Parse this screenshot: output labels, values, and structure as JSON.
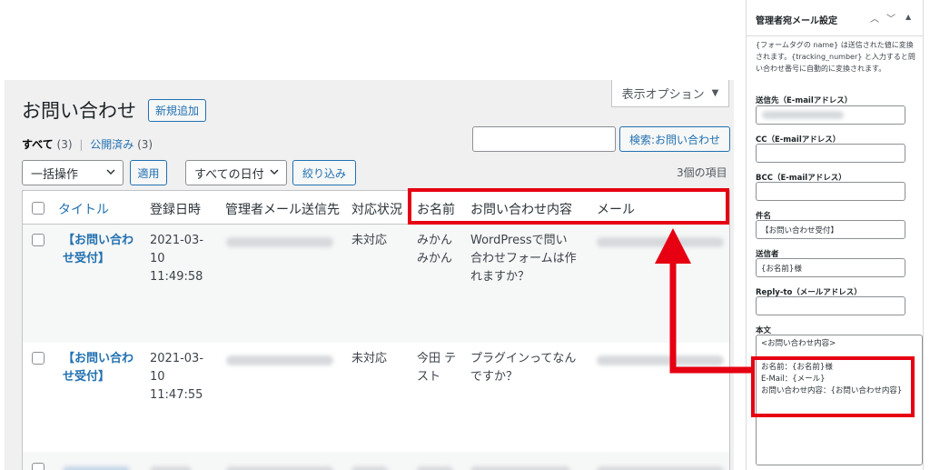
{
  "list": {
    "screen_options_label": "表示オプション",
    "page_title": "お問い合わせ",
    "add_new_label": "新規追加",
    "filter_all_label": "すべて",
    "filter_all_count": "(3)",
    "filter_sep": "|",
    "filter_published_label": "公開済み",
    "filter_published_count": "(3)",
    "search_button_label": "検索:お問い合わせ",
    "bulk_action_value": "一括操作",
    "apply_label": "適用",
    "date_filter_value": "すべての日付",
    "filter_button_label": "絞り込み",
    "items_count": "3個の項目",
    "columns": [
      "タイトル",
      "登録日時",
      "管理者メール送信先",
      "対応状況",
      "お名前",
      "お問い合わせ内容",
      "メール"
    ],
    "rows": [
      {
        "title": "【お問い合わせ受付】",
        "date": "2021-03-10",
        "time": "11:49:58",
        "status": "未対応",
        "name": "みかん みかん",
        "content": "WordPressで問い合わせフォームは作れますか？"
      },
      {
        "title": "【お問い合わせ受付】",
        "date": "2021-03-10",
        "time": "11:47:55",
        "status": "未対応",
        "name": "今田 テスト",
        "content": "プラグインってなんですか？"
      }
    ]
  },
  "panel": {
    "title": "管理者宛メール設定",
    "description": "{フォームタグの name} は送信された値に変換されます。{tracking_number} と入力すると問い合わせ番号に自動的に変換されます。",
    "to_label": "送信先（E-mailアドレス）",
    "cc_label": "CC（E-mailアドレス）",
    "bcc_label": "BCC（E-mailアドレス）",
    "subject_label": "件名",
    "subject_value": "【お問い合わせ受付】",
    "sender_label": "送信者",
    "sender_value": "{お名前}様",
    "replyto_label": "Reply-to（メールアドレス）",
    "body_label": "本文",
    "body_line1": "<お問い合わせ内容>",
    "body_line2": "お名前：{お名前}様",
    "body_line3": "E-Mail：{メール}",
    "body_line4": "お問い合わせ内容：{お問い合わせ内容}"
  },
  "annotation_color": "#e60012",
  "accent_color": "#2271b1"
}
